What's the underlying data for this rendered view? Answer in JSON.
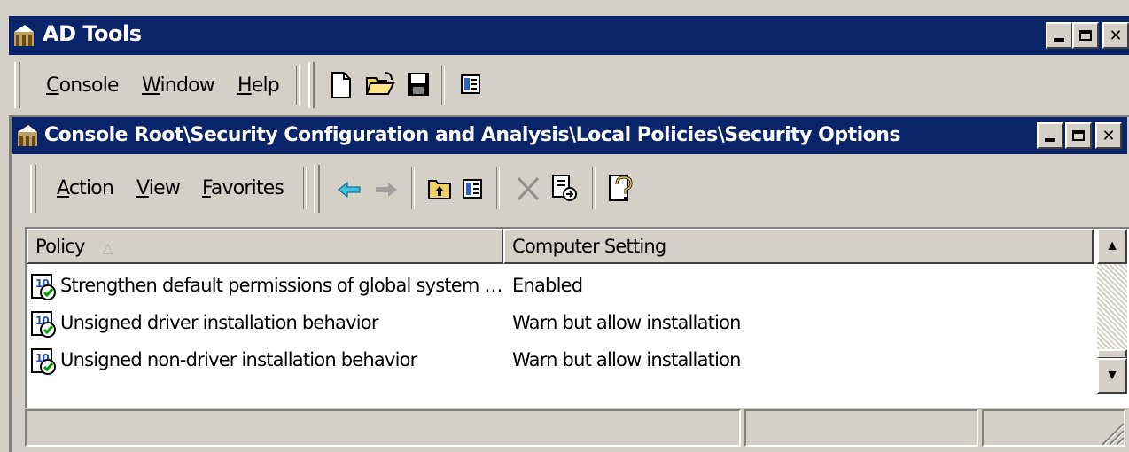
{
  "app": {
    "title": "AD Tools",
    "menu": [
      {
        "label": "Console",
        "mnemonic": "C",
        "rest": "onsole"
      },
      {
        "label": "Window",
        "mnemonic": "W",
        "rest": "indow"
      },
      {
        "label": "Help",
        "mnemonic": "H",
        "rest": "elp"
      }
    ],
    "toolbar_icons": [
      "new-document-icon",
      "open-folder-icon",
      "save-icon",
      "properties-icon"
    ]
  },
  "child": {
    "title": "Console Root\\Security Configuration and Analysis\\Local Policies\\Security Options",
    "menu": [
      {
        "label": "Action",
        "mnemonic": "A",
        "rest": "ction"
      },
      {
        "label": "View",
        "mnemonic": "V",
        "rest": "iew"
      },
      {
        "label": "Favorites",
        "mnemonic": "F",
        "rest": "avorites"
      }
    ],
    "toolbar_icons": [
      "back-arrow-icon",
      "forward-arrow-icon",
      "up-folder-icon",
      "show-hide-tree-icon",
      "delete-icon",
      "export-list-icon",
      "help-icon"
    ]
  },
  "list": {
    "columns": [
      "Policy",
      "Computer Setting"
    ],
    "rows": [
      {
        "policy": "Strengthen default permissions of global system …",
        "setting": "Enabled"
      },
      {
        "policy": "Unsigned driver installation behavior",
        "setting": "Warn but allow installation"
      },
      {
        "policy": "Unsigned non-driver installation behavior",
        "setting": "Warn but allow installation"
      }
    ]
  },
  "colors": {
    "titlebar": "#0a246a",
    "chrome": "#d4d0c8"
  }
}
